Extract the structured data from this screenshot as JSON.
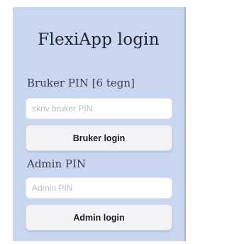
{
  "login": {
    "title": "FlexiApp login",
    "user": {
      "label": "Bruker PIN [6 tegn]",
      "placeholder": "skriv bruker PIN",
      "value": "",
      "button_label": "Bruker login"
    },
    "admin": {
      "label": "Admin PIN",
      "placeholder": "Admin PIN",
      "value": "",
      "button_label": "Admin login"
    }
  }
}
